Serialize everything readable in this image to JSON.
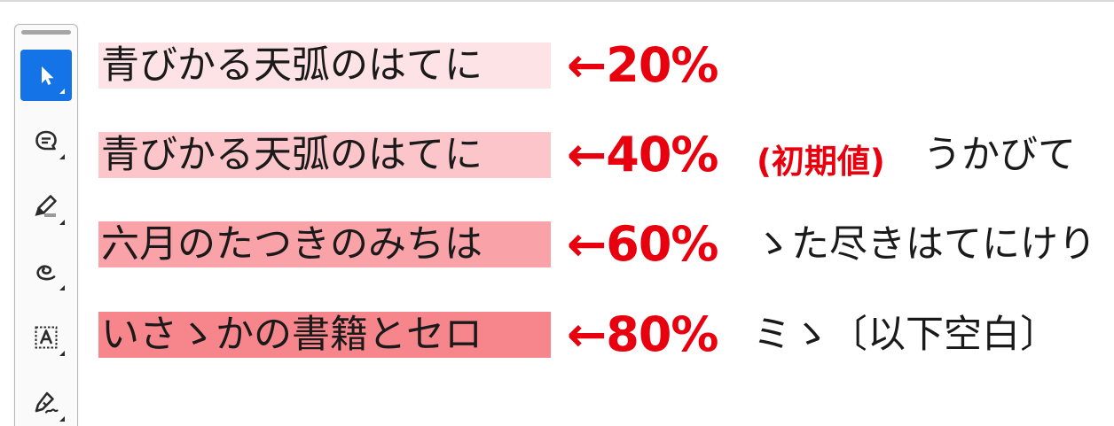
{
  "colors": {
    "accent": "#e8000e",
    "active_tool": "#1473e6",
    "highlight_20": "#fde3e5",
    "highlight_40": "#fbc5c9",
    "highlight_60": "#f9a2a8",
    "highlight_80": "#f7868c"
  },
  "toolbar": {
    "tools": [
      {
        "name": "select-tool",
        "icon": "arrow-pointer-icon",
        "active": true
      },
      {
        "name": "comment-tool",
        "icon": "comment-bubble-icon",
        "active": false
      },
      {
        "name": "highlight-tool",
        "icon": "highlighter-pen-icon",
        "active": false
      },
      {
        "name": "draw-tool",
        "icon": "freehand-loop-icon",
        "active": false
      },
      {
        "name": "text-box-tool",
        "icon": "text-box-A-icon",
        "active": false
      },
      {
        "name": "signature-tool",
        "icon": "pen-signature-icon",
        "active": false
      }
    ]
  },
  "rows": [
    {
      "text": "青びかる天弧のはてに",
      "opacity_label": "←20%",
      "note": "",
      "tail": "",
      "opacity": 20
    },
    {
      "text": "青びかる天弧のはてに",
      "opacity_label": "←40%",
      "note": "(初期値)",
      "tail": "うかびて",
      "opacity": 40
    },
    {
      "text": "六月のたつきのみちは",
      "opacity_label": "←60%",
      "tail": "ゝた尽きはてにけり",
      "note": "",
      "opacity": 60
    },
    {
      "text": "いさゝかの書籍とセロ",
      "opacity_label": "←80%",
      "tail": "ミゝ〔以下空白〕",
      "note": "",
      "opacity": 80
    }
  ]
}
